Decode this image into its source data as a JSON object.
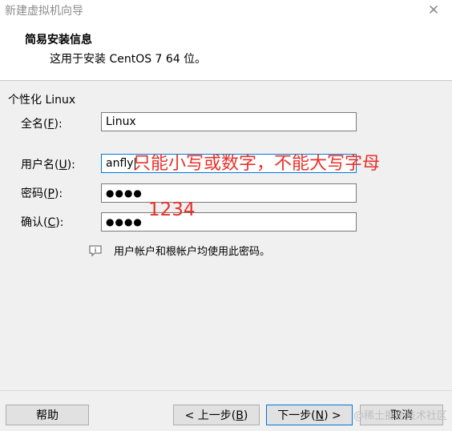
{
  "window": {
    "title": "新建虚拟机向导",
    "close_glyph": "✕"
  },
  "header": {
    "title": "简易安装信息",
    "subtitle": "这用于安装 CentOS 7 64 位。"
  },
  "form": {
    "group_label": "个性化 Linux",
    "fullname": {
      "label_prefix": "全名(",
      "hotkey": "F",
      "label_suffix": "):",
      "value": "Linux"
    },
    "username": {
      "label_prefix": "用户名(",
      "hotkey": "U",
      "label_suffix": "):",
      "value": "anfly"
    },
    "password": {
      "label_prefix": "密码(",
      "hotkey": "P",
      "label_suffix": "):",
      "masked_value": "●●●●"
    },
    "confirm": {
      "label_prefix": "确认(",
      "hotkey": "C",
      "label_suffix": "):",
      "masked_value": "●●●●"
    },
    "info_text": "用户帐户和根帐户均使用此密码。"
  },
  "annotations": {
    "username_hint": "只能小写或数字，不能大写字母",
    "password_hint": "1234",
    "color": "#e8312a"
  },
  "footer": {
    "help_label": "帮助",
    "back_prefix": "< 上一步(",
    "back_hotkey": "B",
    "back_suffix": ")",
    "next_prefix": "下一步(",
    "next_hotkey": "N",
    "next_suffix": ") >",
    "cancel_label": "取消"
  },
  "watermark": "@稀土掘金技术社区"
}
